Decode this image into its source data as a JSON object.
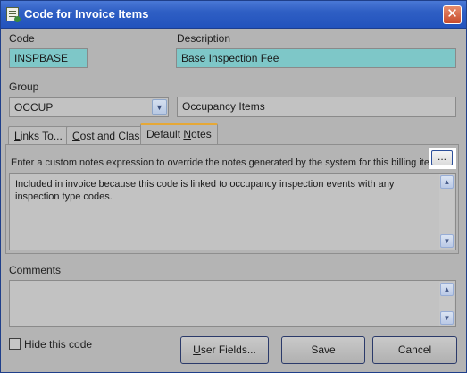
{
  "window": {
    "title": "Code for Invoice Items",
    "close_glyph": "✕"
  },
  "code": {
    "label": "Code",
    "value": "INSPBASE"
  },
  "description": {
    "label": "Description",
    "value": "Base Inspection Fee"
  },
  "group": {
    "label": "Group",
    "value": "OCCUP",
    "description": "Occupancy Items",
    "dropdown_glyph": "▼"
  },
  "tabs": [
    {
      "label_pre": "",
      "label_accel": "L",
      "label_post": "inks To..."
    },
    {
      "label_pre": "",
      "label_accel": "C",
      "label_post": "ost and Class"
    },
    {
      "label_pre": "Default ",
      "label_accel": "N",
      "label_post": "otes",
      "active": true
    }
  ],
  "default_notes": {
    "instruction": "Enter a custom notes expression to override the notes generated by the system for this billing item.",
    "ellipsis_label": "...",
    "notes_text": "Included in invoice because this code is linked to occupancy inspection events with any inspection type codes."
  },
  "comments": {
    "label": "Comments",
    "value": ""
  },
  "scroll": {
    "up_glyph": "▲",
    "down_glyph": "▼"
  },
  "footer": {
    "hide_label": "Hide this code",
    "hide_checked": false,
    "user_fields_accel": "U",
    "user_fields_rest": "ser Fields...",
    "save_label": "Save",
    "cancel_label": "Cancel"
  }
}
